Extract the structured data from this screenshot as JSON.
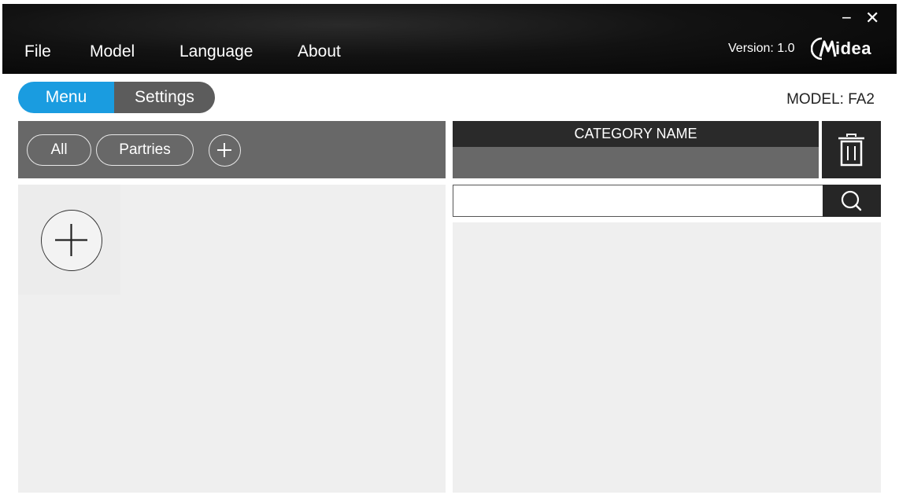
{
  "menubar": {
    "items": [
      "File",
      "Model",
      "Language",
      "About"
    ],
    "version": "Version: 1.0",
    "logo_text": "idea",
    "minimize_glyph": "−",
    "close_glyph": "✕"
  },
  "tabs": {
    "menu_label": "Menu",
    "settings_label": "Settings",
    "active": "Menu"
  },
  "model_label": "MODEL: FA2",
  "categories": {
    "items": [
      "All",
      "Partries"
    ],
    "add_icon": "plus-circle-icon"
  },
  "category_editor": {
    "header": "CATEGORY NAME",
    "value": "",
    "delete_icon": "trash-icon"
  },
  "search": {
    "value": "",
    "placeholder": "",
    "icon": "search-icon"
  },
  "items_panel": {
    "add_icon": "plus-circle-icon"
  },
  "colors": {
    "accent": "#1a9ce0",
    "dark": "#262626",
    "bar_gray": "#686868",
    "panel_bg": "#efefef"
  }
}
